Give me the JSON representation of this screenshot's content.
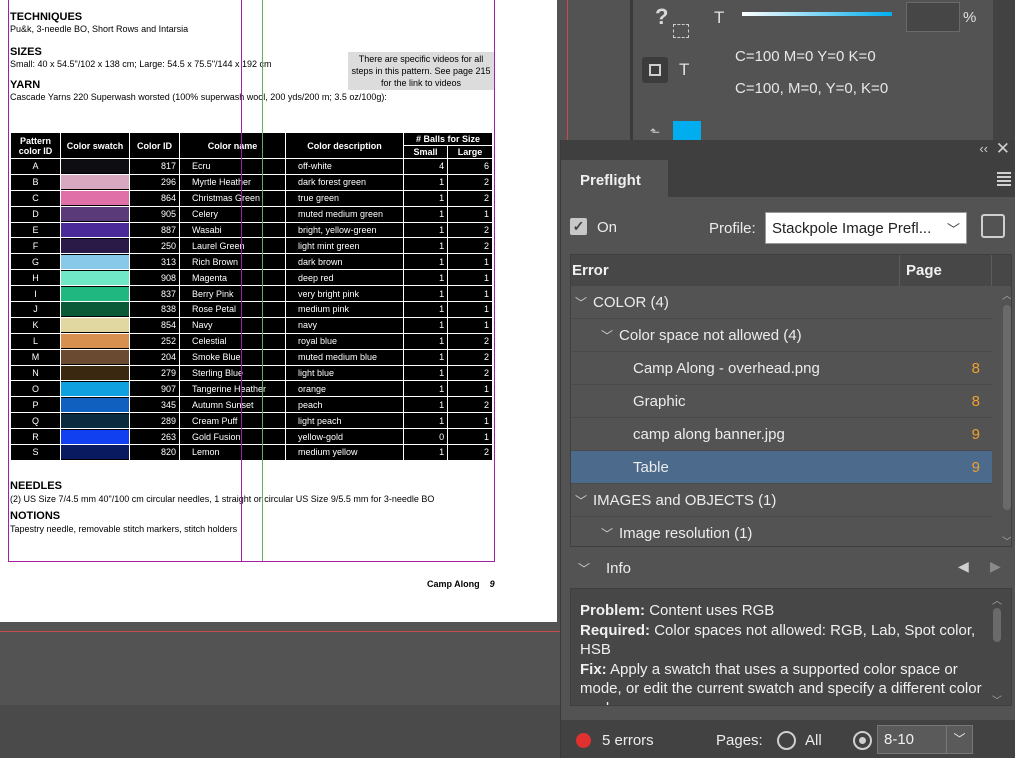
{
  "document": {
    "techniques_heading": "TECHNIQUES",
    "techniques_text": "Pu&k, 3-needle BO, Short Rows and Intarsia",
    "sizes_heading": "SIZES",
    "sizes_text": "Small: 40 x 54.5\"/102 x 138 cm; Large: 54.5 x 75.5\"/144 x 192 cm",
    "yarn_heading": "YARN",
    "yarn_text": "Cascade Yarns 220 Superwash worsted (100% superwash wool, 200 yds/200 m; 3.5 oz/100g):",
    "note": "There are specific videos for all steps in this pattern. See page 215 for the link to videos",
    "table": {
      "headers": [
        "Pattern color ID",
        "Color swatch",
        "Color ID",
        "Color name",
        "Color description",
        "# Balls for Size"
      ],
      "subheaders": [
        "Small",
        "Large"
      ],
      "rows": [
        {
          "id": "A",
          "swatch": "#0d0d12",
          "cid": "817",
          "name": "Ecru",
          "desc": "off-white",
          "small": "4",
          "large": "6"
        },
        {
          "id": "B",
          "swatch": "#d8a8c0",
          "cid": "296",
          "name": "Myrtle Heather",
          "desc": "dark forest green",
          "small": "1",
          "large": "2"
        },
        {
          "id": "C",
          "swatch": "#e070a8",
          "cid": "864",
          "name": "Christmas Green",
          "desc": "true green",
          "small": "1",
          "large": "2"
        },
        {
          "id": "D",
          "swatch": "#5a3a78",
          "cid": "905",
          "name": "Celery",
          "desc": "muted medium green",
          "small": "1",
          "large": "1"
        },
        {
          "id": "E",
          "swatch": "#4a2a98",
          "cid": "887",
          "name": "Wasabi",
          "desc": "bright, yellow-green",
          "small": "1",
          "large": "2"
        },
        {
          "id": "F",
          "swatch": "#2a1a48",
          "cid": "250",
          "name": "Laurel Green",
          "desc": "light mint green",
          "small": "1",
          "large": "2"
        },
        {
          "id": "G",
          "swatch": "#88c8e8",
          "cid": "313",
          "name": "Rich Brown",
          "desc": "dark brown",
          "small": "1",
          "large": "1"
        },
        {
          "id": "H",
          "swatch": "#70e8c8",
          "cid": "908",
          "name": "Magenta",
          "desc": "deep red",
          "small": "1",
          "large": "1"
        },
        {
          "id": "I",
          "swatch": "#20b880",
          "cid": "837",
          "name": "Berry Pink",
          "desc": "very bright pink",
          "small": "1",
          "large": "1"
        },
        {
          "id": "J",
          "swatch": "#0a5a38",
          "cid": "838",
          "name": "Rose Petal",
          "desc": "medium pink",
          "small": "1",
          "large": "1"
        },
        {
          "id": "K",
          "swatch": "#e0d8a0",
          "cid": "854",
          "name": "Navy",
          "desc": "navy",
          "small": "1",
          "large": "1"
        },
        {
          "id": "L",
          "swatch": "#d89050",
          "cid": "252",
          "name": "Celestial",
          "desc": "royal blue",
          "small": "1",
          "large": "2"
        },
        {
          "id": "M",
          "swatch": "#6a4a30",
          "cid": "204",
          "name": "Smoke Blue",
          "desc": "muted medium blue",
          "small": "1",
          "large": "2"
        },
        {
          "id": "N",
          "swatch": "#3a2810",
          "cid": "279",
          "name": "Sterling Blue",
          "desc": "light blue",
          "small": "1",
          "large": "2"
        },
        {
          "id": "O",
          "swatch": "#10a0e0",
          "cid": "907",
          "name": "Tangerine Heather",
          "desc": "orange",
          "small": "1",
          "large": "1"
        },
        {
          "id": "P",
          "swatch": "#1060c0",
          "cid": "345",
          "name": "Autumn Sunset",
          "desc": "peach",
          "small": "1",
          "large": "2"
        },
        {
          "id": "Q",
          "swatch": "#0a2a40",
          "cid": "289",
          "name": "Cream Puff",
          "desc": "light peach",
          "small": "1",
          "large": "1"
        },
        {
          "id": "R",
          "swatch": "#1040f0",
          "cid": "263",
          "name": "Gold Fusion",
          "desc": "yellow-gold",
          "small": "0",
          "large": "1"
        },
        {
          "id": "S",
          "swatch": "#0a1a60",
          "cid": "820",
          "name": "Lemon",
          "desc": "medium yellow",
          "small": "1",
          "large": "2"
        }
      ]
    },
    "needles_heading": "NEEDLES",
    "needles_text": "(2) US Size 7/4.5 mm 40\"/100 cm circular needles, 1 straight or circular US Size 9/5.5 mm for 3-needle BO",
    "notions_heading": "NOTIONS",
    "notions_text": "Tapestry needle, removable stitch markers, stitch holders",
    "footer_title": "Camp Along",
    "footer_page": "9"
  },
  "color_panel": {
    "question_icon": "?",
    "t_label": "T",
    "percent": "%",
    "cmyk_1": "C=100 M=0 Y=0 K=0",
    "cmyk_2": "C=100, M=0, Y=0, K=0"
  },
  "preflight": {
    "tab": "Preflight",
    "on_label": "On",
    "profile_label": "Profile:",
    "profile_value": "Stackpole Image Prefl...",
    "col_error": "Error",
    "col_page": "Page",
    "rows": [
      {
        "label": "COLOR (4)",
        "page": ""
      },
      {
        "label": "Color space not allowed (4)",
        "page": ""
      },
      {
        "label": "Camp Along - overhead.png",
        "page": "8"
      },
      {
        "label": "Graphic",
        "page": "8"
      },
      {
        "label": "camp along banner.jpg",
        "page": "9"
      },
      {
        "label": "Table",
        "page": "9"
      },
      {
        "label": "IMAGES and OBJECTS (1)",
        "page": ""
      },
      {
        "label": "Image resolution (1)",
        "page": ""
      }
    ],
    "info_label": "Info",
    "problem_label": "Problem:",
    "problem_text": "Content uses RGB",
    "required_label": "Required:",
    "required_text": "Color spaces not allowed: RGB, Lab, Spot color, HSB",
    "fix_label": "Fix:",
    "fix_text": "Apply a swatch that uses a supported color space or mode, or edit the current swatch and specify a different color mode.",
    "errors_text": "5 errors",
    "pages_label": "Pages:",
    "all_label": "All",
    "pages_value": "8-10"
  }
}
